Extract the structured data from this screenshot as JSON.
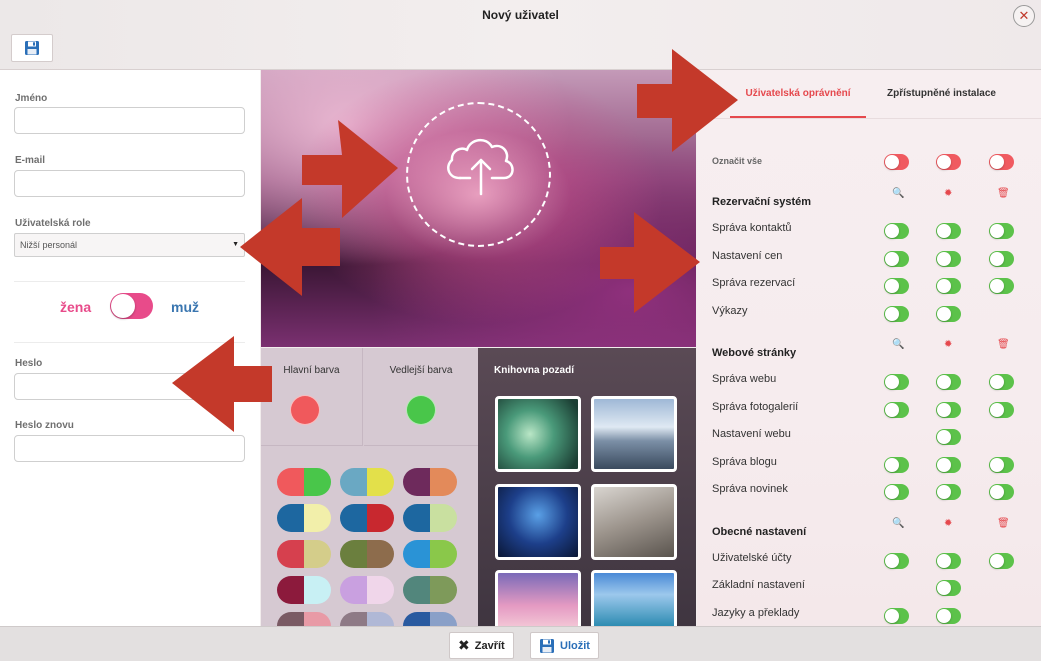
{
  "window": {
    "title": "Nový uživatel",
    "close_glyph": "✕",
    "save_icon": "floppy-disk-icon",
    "accent": "#e5484d"
  },
  "form": {
    "name_label": "Jméno",
    "name_value": "",
    "email_label": "E-mail",
    "email_value": "",
    "role_label": "Uživatelská role",
    "role_value": "Nižší personál",
    "gender_female": "žena",
    "gender_male": "muž",
    "password_label": "Heslo",
    "password_value": "",
    "password_again_label": "Heslo znovu",
    "password_again_value": ""
  },
  "colors": {
    "main_label": "Hlavní barva",
    "main_color": "#f0595c",
    "secondary_label": "Vedlejší barva",
    "secondary_color": "#49c64a",
    "pairs": [
      [
        "#f0595c",
        "#49c64a"
      ],
      [
        "#6aa8c3",
        "#e3e04a"
      ],
      [
        "#6e2a5c",
        "#e38a5a"
      ],
      [
        "#1d67a0",
        "#f2efaa"
      ],
      [
        "#1d67a0",
        "#c8282f"
      ],
      [
        "#1d67a0",
        "#c9e0a0"
      ],
      [
        "#d6404e",
        "#d4cd8a"
      ],
      [
        "#6b7f3e",
        "#8d6c4c"
      ],
      [
        "#2a93d6",
        "#8ac84a"
      ],
      [
        "#8c1a3c",
        "#c8f0f4"
      ],
      [
        "#c9a0e0",
        "#f0d6ea"
      ],
      [
        "#52867c",
        "#7e9a5a"
      ],
      [
        "#7a5a64",
        "#e89aa6"
      ],
      [
        "#8e7a86",
        "#b0b8d6"
      ],
      [
        "#2a5aa0",
        "#8aa0c8"
      ]
    ]
  },
  "library": {
    "title": "Knihovna pozadí"
  },
  "permissions": {
    "tabs": [
      "Uživatelská oprávnění",
      "Zpřístupněné instalace"
    ],
    "select_all": "Označit vše",
    "column_icons": [
      "search-icon",
      "gear-icon",
      "trash-icon"
    ],
    "sections": [
      {
        "title": "Rezervační systém",
        "rows": [
          {
            "label": "Správa kontaktů",
            "toggles": [
              true,
              true,
              true
            ]
          },
          {
            "label": "Nastavení cen",
            "toggles": [
              true,
              true,
              true
            ]
          },
          {
            "label": "Správa rezervací",
            "toggles": [
              true,
              true,
              true
            ]
          },
          {
            "label": "Výkazy",
            "toggles": [
              true,
              true,
              null
            ]
          }
        ]
      },
      {
        "title": "Webové stránky",
        "rows": [
          {
            "label": "Správa webu",
            "toggles": [
              true,
              true,
              true
            ]
          },
          {
            "label": "Správa fotogalerií",
            "toggles": [
              true,
              true,
              true
            ]
          },
          {
            "label": "Nastavení webu",
            "toggles": [
              null,
              true,
              null
            ]
          },
          {
            "label": "Správa blogu",
            "toggles": [
              true,
              true,
              true
            ]
          },
          {
            "label": "Správa novinek",
            "toggles": [
              true,
              true,
              true
            ]
          }
        ]
      },
      {
        "title": "Obecné nastavení",
        "rows": [
          {
            "label": "Uživatelské účty",
            "toggles": [
              true,
              true,
              true
            ]
          },
          {
            "label": "Základní nastavení",
            "toggles": [
              null,
              true,
              null
            ]
          },
          {
            "label": "Jazyky a překlady",
            "toggles": [
              true,
              true,
              null
            ]
          }
        ]
      }
    ]
  },
  "footer": {
    "close_label": "Zavřít",
    "save_label": "Uložit"
  }
}
